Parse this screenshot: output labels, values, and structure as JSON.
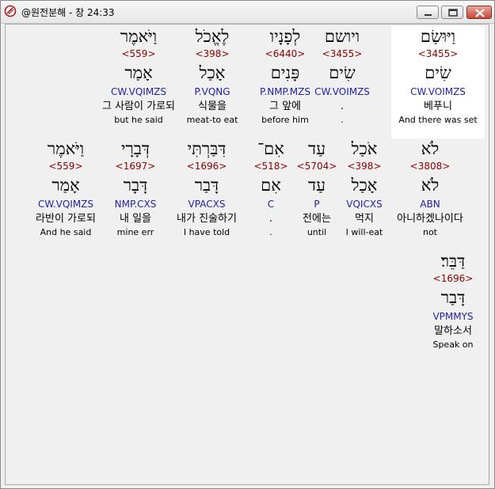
{
  "window": {
    "title": "@원전분해 - 창 24:33",
    "title_icon": "app-logo-icon",
    "buttons": {
      "minimize": "minimize-icon",
      "maximize": "maximize-icon",
      "close": "close-icon"
    }
  },
  "rows": [
    {
      "words": [
        {
          "heb": "וַיּוּשַׂם",
          "strong": "<3455>",
          "lemma": "שִׂים",
          "parse": "CW.VOIMZS",
          "kor": "베푸니",
          "eng": "And there was set",
          "selected": true
        },
        {
          "heb": "ויושם",
          "strong": "<3455>",
          "lemma": "שִׂים",
          "parse": "CW.VOIMZS",
          "kor": ".",
          "eng": "."
        },
        {
          "heb": "לְפָנָיו",
          "strong": "<6440>",
          "lemma": "פָּנִים",
          "parse": "P.NMP.MZS",
          "kor": "그 앞에",
          "eng": "before him"
        },
        {
          "heb": "לֶאֱכֹל",
          "strong": "<398>",
          "lemma": "אָכַל",
          "parse": "P.VQNG",
          "kor": "식물을",
          "eng": "meat-to eat"
        },
        {
          "heb": "וַיֹּאמֶר",
          "strong": "<559>",
          "lemma": "אָמַר",
          "parse": "CW.VQIMZS",
          "kor": "그 사람이 가로되",
          "eng": "but he said"
        }
      ]
    },
    {
      "words": [
        {
          "heb": "לֹא",
          "strong": "<3808>",
          "lemma": "לֹא",
          "parse": "ABN",
          "kor": "아니하겠나이다",
          "eng": "not"
        },
        {
          "heb": "אֹכַל",
          "strong": "<398>",
          "lemma": "אָכַל",
          "parse": "VQICXS",
          "kor": "먹지",
          "eng": "I will-eat"
        },
        {
          "heb": "עַד",
          "strong": "<5704>",
          "lemma": "עַד",
          "parse": "P",
          "kor": "전에는",
          "eng": "until"
        },
        {
          "heb": "אִם־",
          "strong": "<518>",
          "lemma": "אִם",
          "parse": "C",
          "kor": ".",
          "eng": "."
        },
        {
          "heb": "דִּבַּרְתִּי",
          "strong": "<1696>",
          "lemma": "דָּבַר",
          "parse": "VPACXS",
          "kor": "내가 진술하기",
          "eng": "I have told"
        },
        {
          "heb": "דְּבָרָי",
          "strong": "<1697>",
          "lemma": "דָּבָר",
          "parse": "NMP.CXS",
          "kor": "내 일을",
          "eng": "mine err"
        },
        {
          "heb": "וַיֹּאמֶר",
          "strong": "<559>",
          "lemma": "אָמַר",
          "parse": "CW.VQIMZS",
          "kor": "라반이 가로되",
          "eng": "And he said"
        }
      ]
    },
    {
      "words": [
        {
          "heb": "דַּבֵּר׃",
          "strong": "<1696>",
          "lemma": "דָּבַר",
          "parse": "VPMMYS",
          "kor": "말하소서",
          "eng": "Speak on"
        }
      ]
    }
  ]
}
